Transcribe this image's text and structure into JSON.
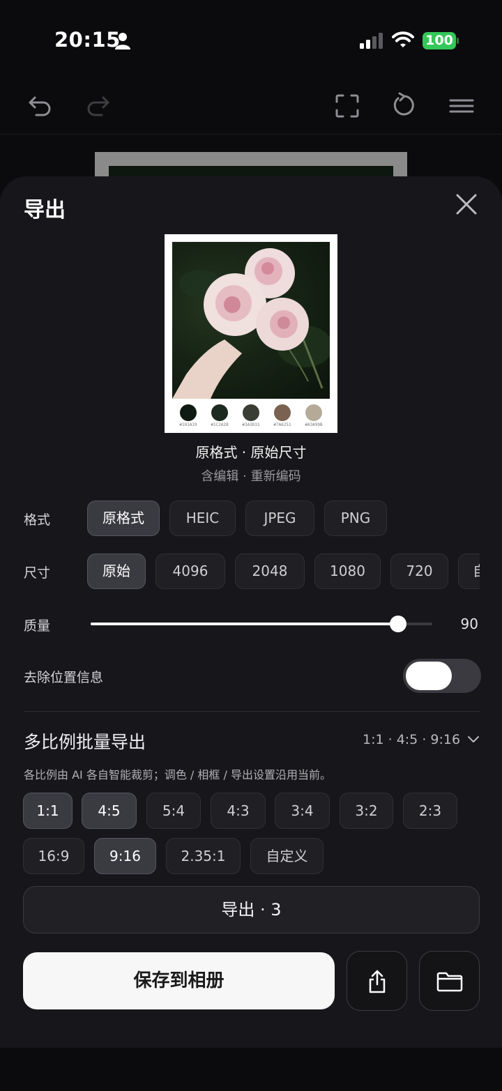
{
  "status": {
    "time": "20:15",
    "battery": "100"
  },
  "sheet": {
    "title": "导出",
    "preview": {
      "caption": "原格式 · 原始尺寸",
      "subcaption": "含编辑 · 重新编码",
      "palette": [
        {
          "color": "#101a14",
          "label": "#101A19"
        },
        {
          "color": "#1c2a1f",
          "label": "#1C2A28"
        },
        {
          "color": "#3a3d33",
          "label": "#3A3D31"
        },
        {
          "color": "#7a6251",
          "label": "#7A6251"
        },
        {
          "color": "#b5aa98",
          "label": "#A3A99B"
        }
      ]
    },
    "format": {
      "label": "格式",
      "options": [
        "原格式",
        "HEIC",
        "JPEG",
        "PNG"
      ],
      "selected": "原格式"
    },
    "size": {
      "label": "尺寸",
      "options": [
        "原始",
        "4096",
        "2048",
        "1080",
        "720",
        "自定义"
      ],
      "selected": "原始"
    },
    "quality": {
      "label": "质量",
      "value": 90,
      "min": 0,
      "max": 100
    },
    "strip_location": {
      "label": "去除位置信息",
      "enabled": false
    },
    "batch": {
      "title": "多比例批量导出",
      "summary": "1:1 · 4:5 · 9:16",
      "description": "各比例由 AI 各自智能裁剪；调色 / 相框 / 导出设置沿用当前。",
      "ratios_row1": [
        "1:1",
        "4:5",
        "5:4",
        "4:3",
        "3:4",
        "3:2",
        "2:3"
      ],
      "ratios_row2": [
        "16:9",
        "9:16",
        "2.35:1",
        "自定义"
      ],
      "selected": [
        "1:1",
        "4:5",
        "9:16"
      ]
    },
    "export_button": "导出 · 3",
    "save_button": "保存到相册"
  }
}
